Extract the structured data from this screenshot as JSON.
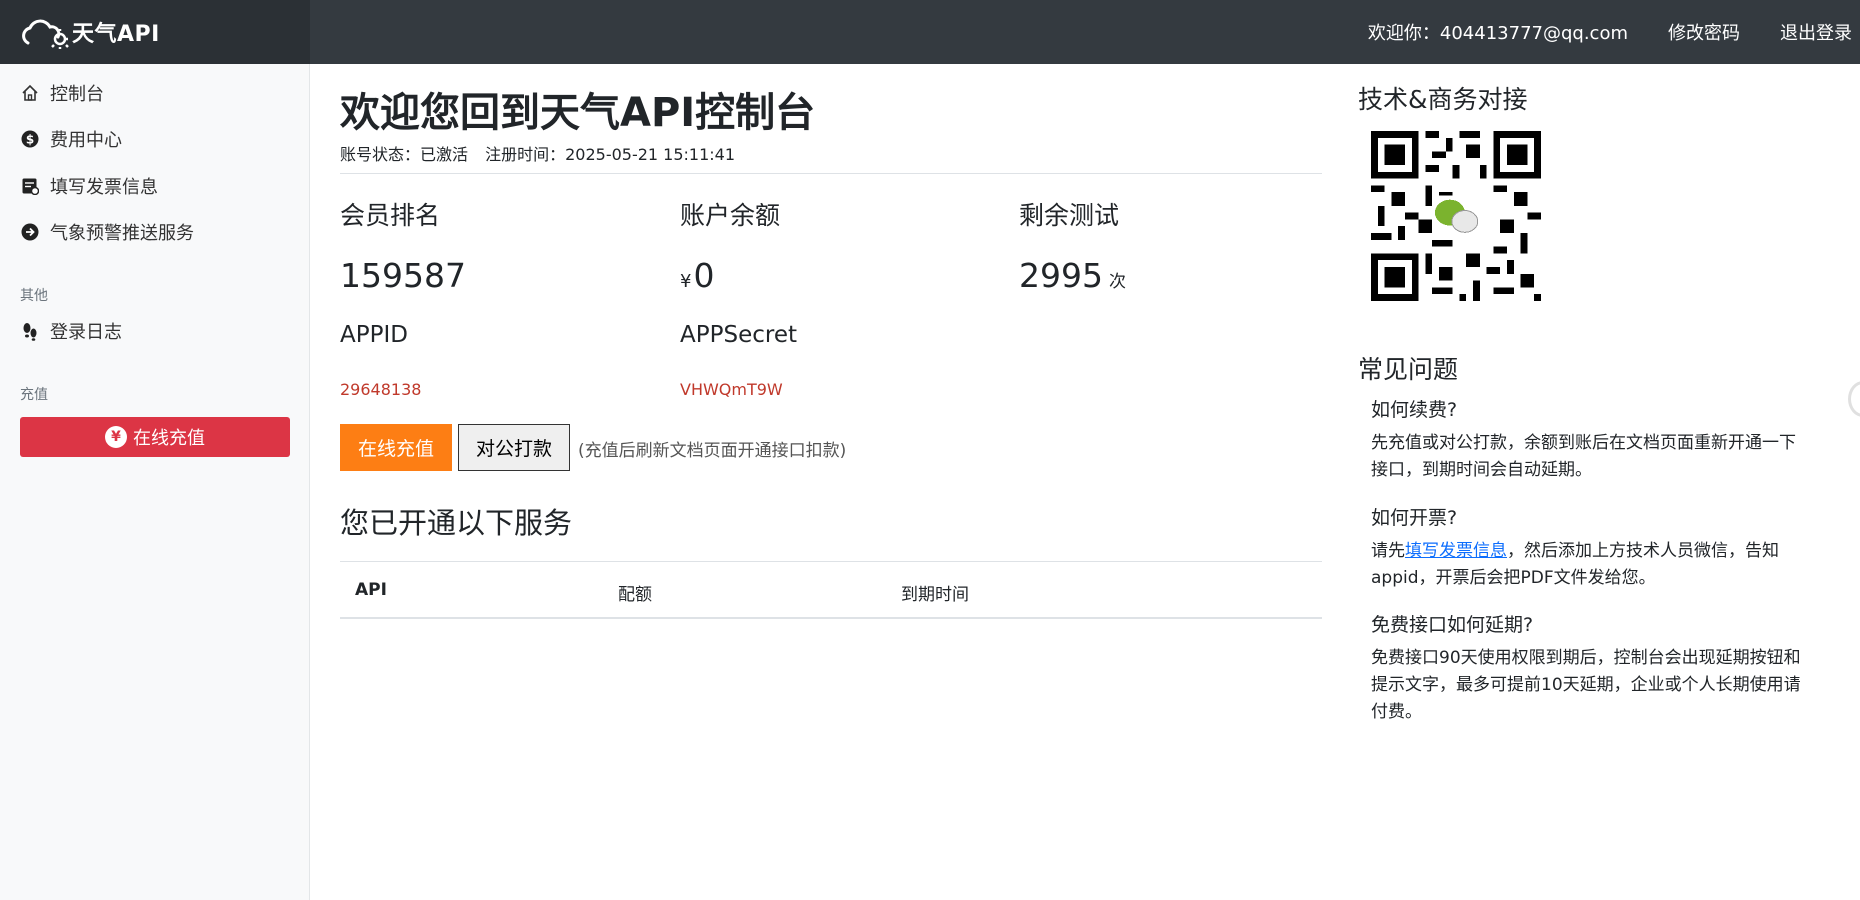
{
  "navbar": {
    "brand": "天气API",
    "welcome": "欢迎你：404413777@qq.com",
    "change_password": "修改密码",
    "logout": "退出登录"
  },
  "sidebar": {
    "items": [
      {
        "label": "控制台",
        "icon": "home-icon"
      },
      {
        "label": "费用中心",
        "icon": "dollar-circle-icon"
      },
      {
        "label": "填写发票信息",
        "icon": "invoice-icon"
      },
      {
        "label": "气象预警推送服务",
        "icon": "arrow-circle-icon"
      }
    ],
    "other_heading": "其他",
    "login_log": "登录日志",
    "recharge_heading": "充值",
    "recharge_button": "在线充值",
    "recharge_symbol": "¥"
  },
  "main": {
    "title": "欢迎您回到天气API控制台",
    "account_status": "账号状态：已激活",
    "register_time": "注册时间：2025-05-21 15:11:41",
    "stats": {
      "rank_label": "会员排名",
      "rank_value": "159587",
      "balance_label": "账户余额",
      "balance_currency": "¥",
      "balance_value": "0",
      "tests_label": "剩余测试",
      "tests_value": "2995",
      "tests_unit": "次"
    },
    "credentials": {
      "appid_label": "APPID",
      "appid_value": "29648138",
      "secret_label": "APPSecret",
      "secret_value": "VHWQmT9W"
    },
    "buttons": {
      "online_recharge": "在线充值",
      "bank_transfer": "对公打款",
      "note": "(充值后刷新文档页面开通接口扣款)"
    },
    "services_title": "您已开通以下服务",
    "table_headers": [
      "API",
      "配额",
      "到期时间"
    ]
  },
  "right": {
    "contact_title": "技术&商务对接",
    "faq_title": "常见问题",
    "faq": [
      {
        "q": "如何续费?",
        "a": "先充值或对公打款，余额到账后在文档页面重新开通一下接口，到期时间会自动延期。"
      },
      {
        "q": "如何开票?",
        "a_pre": "请先",
        "a_link": "填写发票信息",
        "a_post": "，然后添加上方技术人员微信，告知appid，开票后会把PDF文件发给您。"
      },
      {
        "q": "免费接口如何延期?",
        "a": "免费接口90天使用权限到期后，控制台会出现延期按钮和提示文字，最多可提前10天延期，企业或个人长期使用请付费。"
      }
    ]
  },
  "colors": {
    "navbar_bg": "#343a40",
    "danger": "#dc3545",
    "orange": "#fd7e14",
    "credential_red": "#c0392b",
    "link": "#0d6efd"
  }
}
